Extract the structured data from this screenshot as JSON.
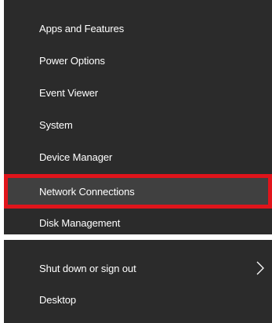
{
  "menu": {
    "top_items": [
      {
        "label": "Apps and Features"
      },
      {
        "label": "Power Options"
      },
      {
        "label": "Event Viewer"
      },
      {
        "label": "System"
      },
      {
        "label": "Device Manager"
      },
      {
        "label": "Network Connections"
      },
      {
        "label": "Disk Management"
      }
    ],
    "bottom_items": [
      {
        "label": "Shut down or sign out",
        "icon": "chevron-right-icon"
      },
      {
        "label": "Desktop"
      }
    ],
    "highlighted_item": "Network Connections"
  },
  "colors": {
    "menu_background": "#2b2b2b",
    "text": "#ffffff",
    "highlight_outline": "#e0141b",
    "page_background": "#ffffff"
  }
}
